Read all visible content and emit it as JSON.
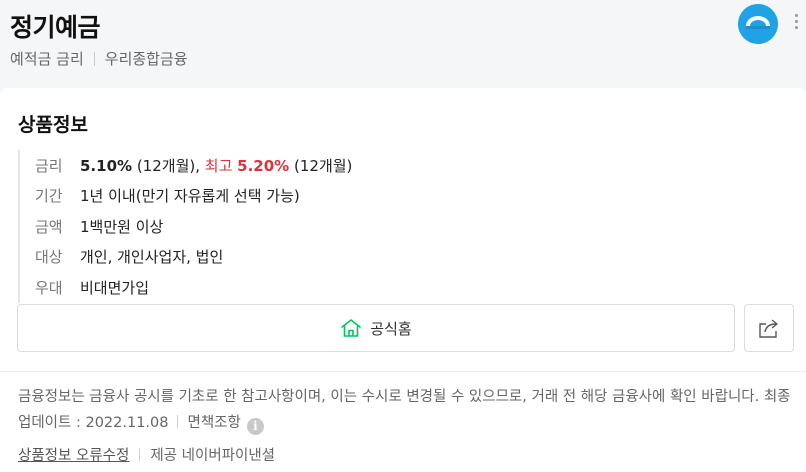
{
  "header": {
    "title": "정기예금",
    "breadcrumb": [
      "예적금 금리",
      "우리종합금융"
    ],
    "logo_icon": "woori-bank-logo-icon",
    "more_icon": "more-vertical-icon",
    "logo_color": "#1fa3e6"
  },
  "product": {
    "section_title": "상품정보",
    "rows": [
      {
        "label": "금리",
        "rate": "5.10%",
        "rate_term": "(12개월),",
        "max_label": "최고",
        "max_rate": "5.20%",
        "max_term": "(12개월)"
      },
      {
        "label": "기간",
        "value": "1년 이내(만기 자유롭게 선택 가능)"
      },
      {
        "label": "금액",
        "value": "1백만원 이상"
      },
      {
        "label": "대상",
        "value": "개인, 개인사업자, 법인"
      },
      {
        "label": "우대",
        "value": "비대면가입"
      }
    ],
    "accent_red": "#e0303b"
  },
  "actions": {
    "home_label": "공식홈",
    "home_icon": "home-icon",
    "share_icon": "share-icon",
    "home_icon_color": "#03c75a"
  },
  "notice": {
    "text": "금융정보는 금융사 공시를 기초로 한 참고사항이며, 이는 수시로 변경될 수 있으므로, 거래 전 해당 금융사에 확인 바랍니다. 최종 업데이트 : 2022.11.08",
    "disclaimer_label": "면책조항",
    "info_icon": "info-icon"
  },
  "footer": {
    "report_label": "상품정보 오류수정",
    "provider_label": "제공 네이버파이낸셜"
  }
}
